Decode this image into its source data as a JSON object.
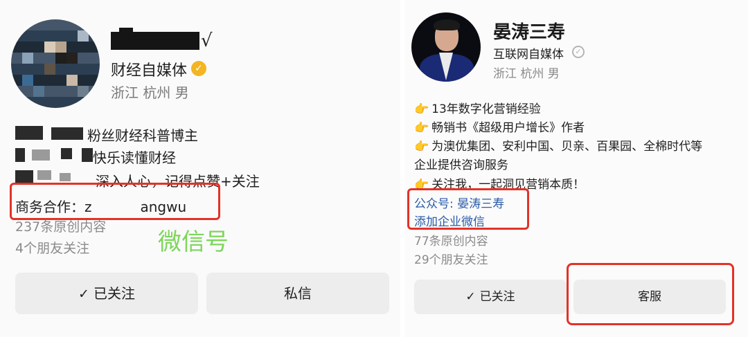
{
  "left": {
    "title": "财经自媒体",
    "location": "浙江 杭州 男",
    "bio_lines": [
      "粉丝财经科普博主",
      "快乐读懂财经",
      "深入人心，记得点赞+关注"
    ],
    "business_label": "商务合作：z",
    "business_suffix": "angwu",
    "original_count": "237条原创内容",
    "friends_follow": "4个朋友关注",
    "annotation": "微信号",
    "follow_button": "已关注",
    "message_button": "私信",
    "check_glyph": "✓",
    "name_check_glyph": "√",
    "verified_glyph": "✓"
  },
  "right": {
    "name": "晏涛三寿",
    "title": "互联网自媒体",
    "location": "浙江 杭州 男",
    "bio_lines": [
      "13年数字化营销经验",
      "畅销书《超级用户增长》作者",
      "为澳优集团、安利中国、贝亲、百果园、全棉时代等",
      "企业提供咨询服务",
      "关注我，一起洞见营销本质！"
    ],
    "official_account": "公众号: 晏涛三寿",
    "add_wechat": "添加企业微信",
    "original_count": "77条原创内容",
    "friends_follow": "29个朋友关注",
    "follow_button": "已关注",
    "service_button": "客服",
    "hand_glyph": "👉",
    "check_glyph": "✓",
    "verified_glyph": "✓"
  },
  "colors": {
    "annotation_red": "#e53126",
    "link_blue": "#2a5aa8",
    "wechat_green": "#7cd65a",
    "verified_gold": "#f3b521"
  }
}
